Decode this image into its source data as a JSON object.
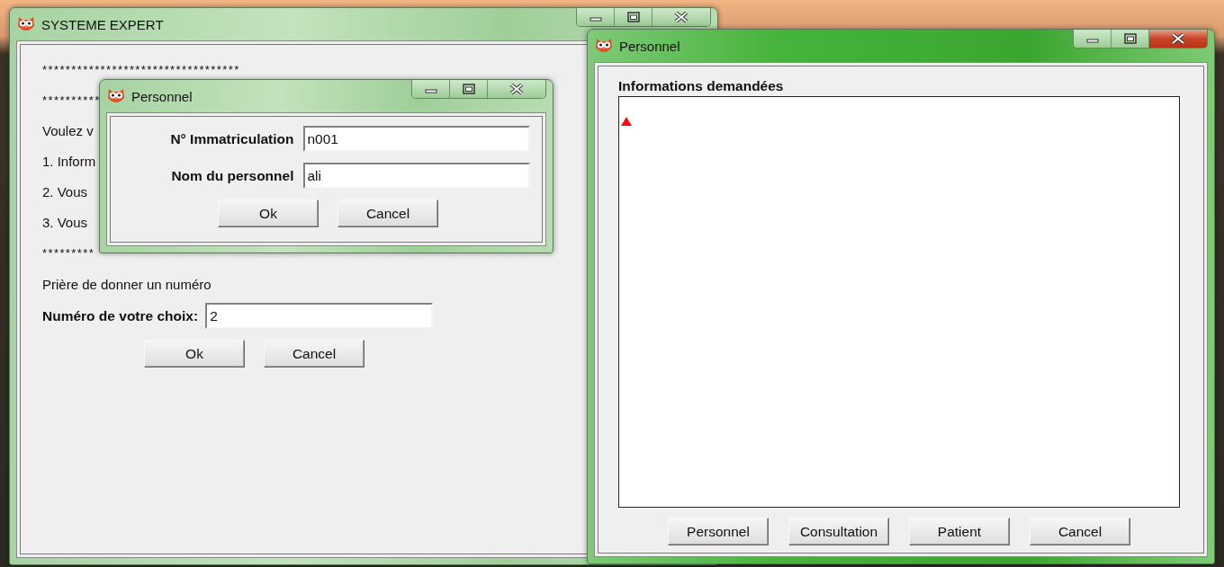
{
  "windows": [
    {
      "kind": "main",
      "title": "SYSTEME EXPERT",
      "active": false,
      "lines": [
        "**********************************",
        "**********",
        "Voulez v",
        "1. Inform",
        "2. Vous",
        "3. Vous",
        "*********"
      ],
      "prompt": "Prière de donner un numéro",
      "field": {
        "label": "Numéro de votre choix:",
        "value": "2"
      },
      "buttons": [
        "Ok",
        "Cancel"
      ]
    },
    {
      "kind": "form",
      "title": "Personnel",
      "active": false,
      "fields": [
        {
          "label": "N° Immatriculation",
          "value": "n001"
        },
        {
          "label": "Nom du personnel",
          "value": "ali"
        }
      ],
      "buttons": [
        "Ok",
        "Cancel"
      ]
    },
    {
      "kind": "info",
      "title": "Personnel",
      "active": true,
      "section_label": "Informations demandées",
      "buttons": [
        "Personnel",
        "Consultation",
        "Patient",
        "Cancel"
      ]
    }
  ]
}
